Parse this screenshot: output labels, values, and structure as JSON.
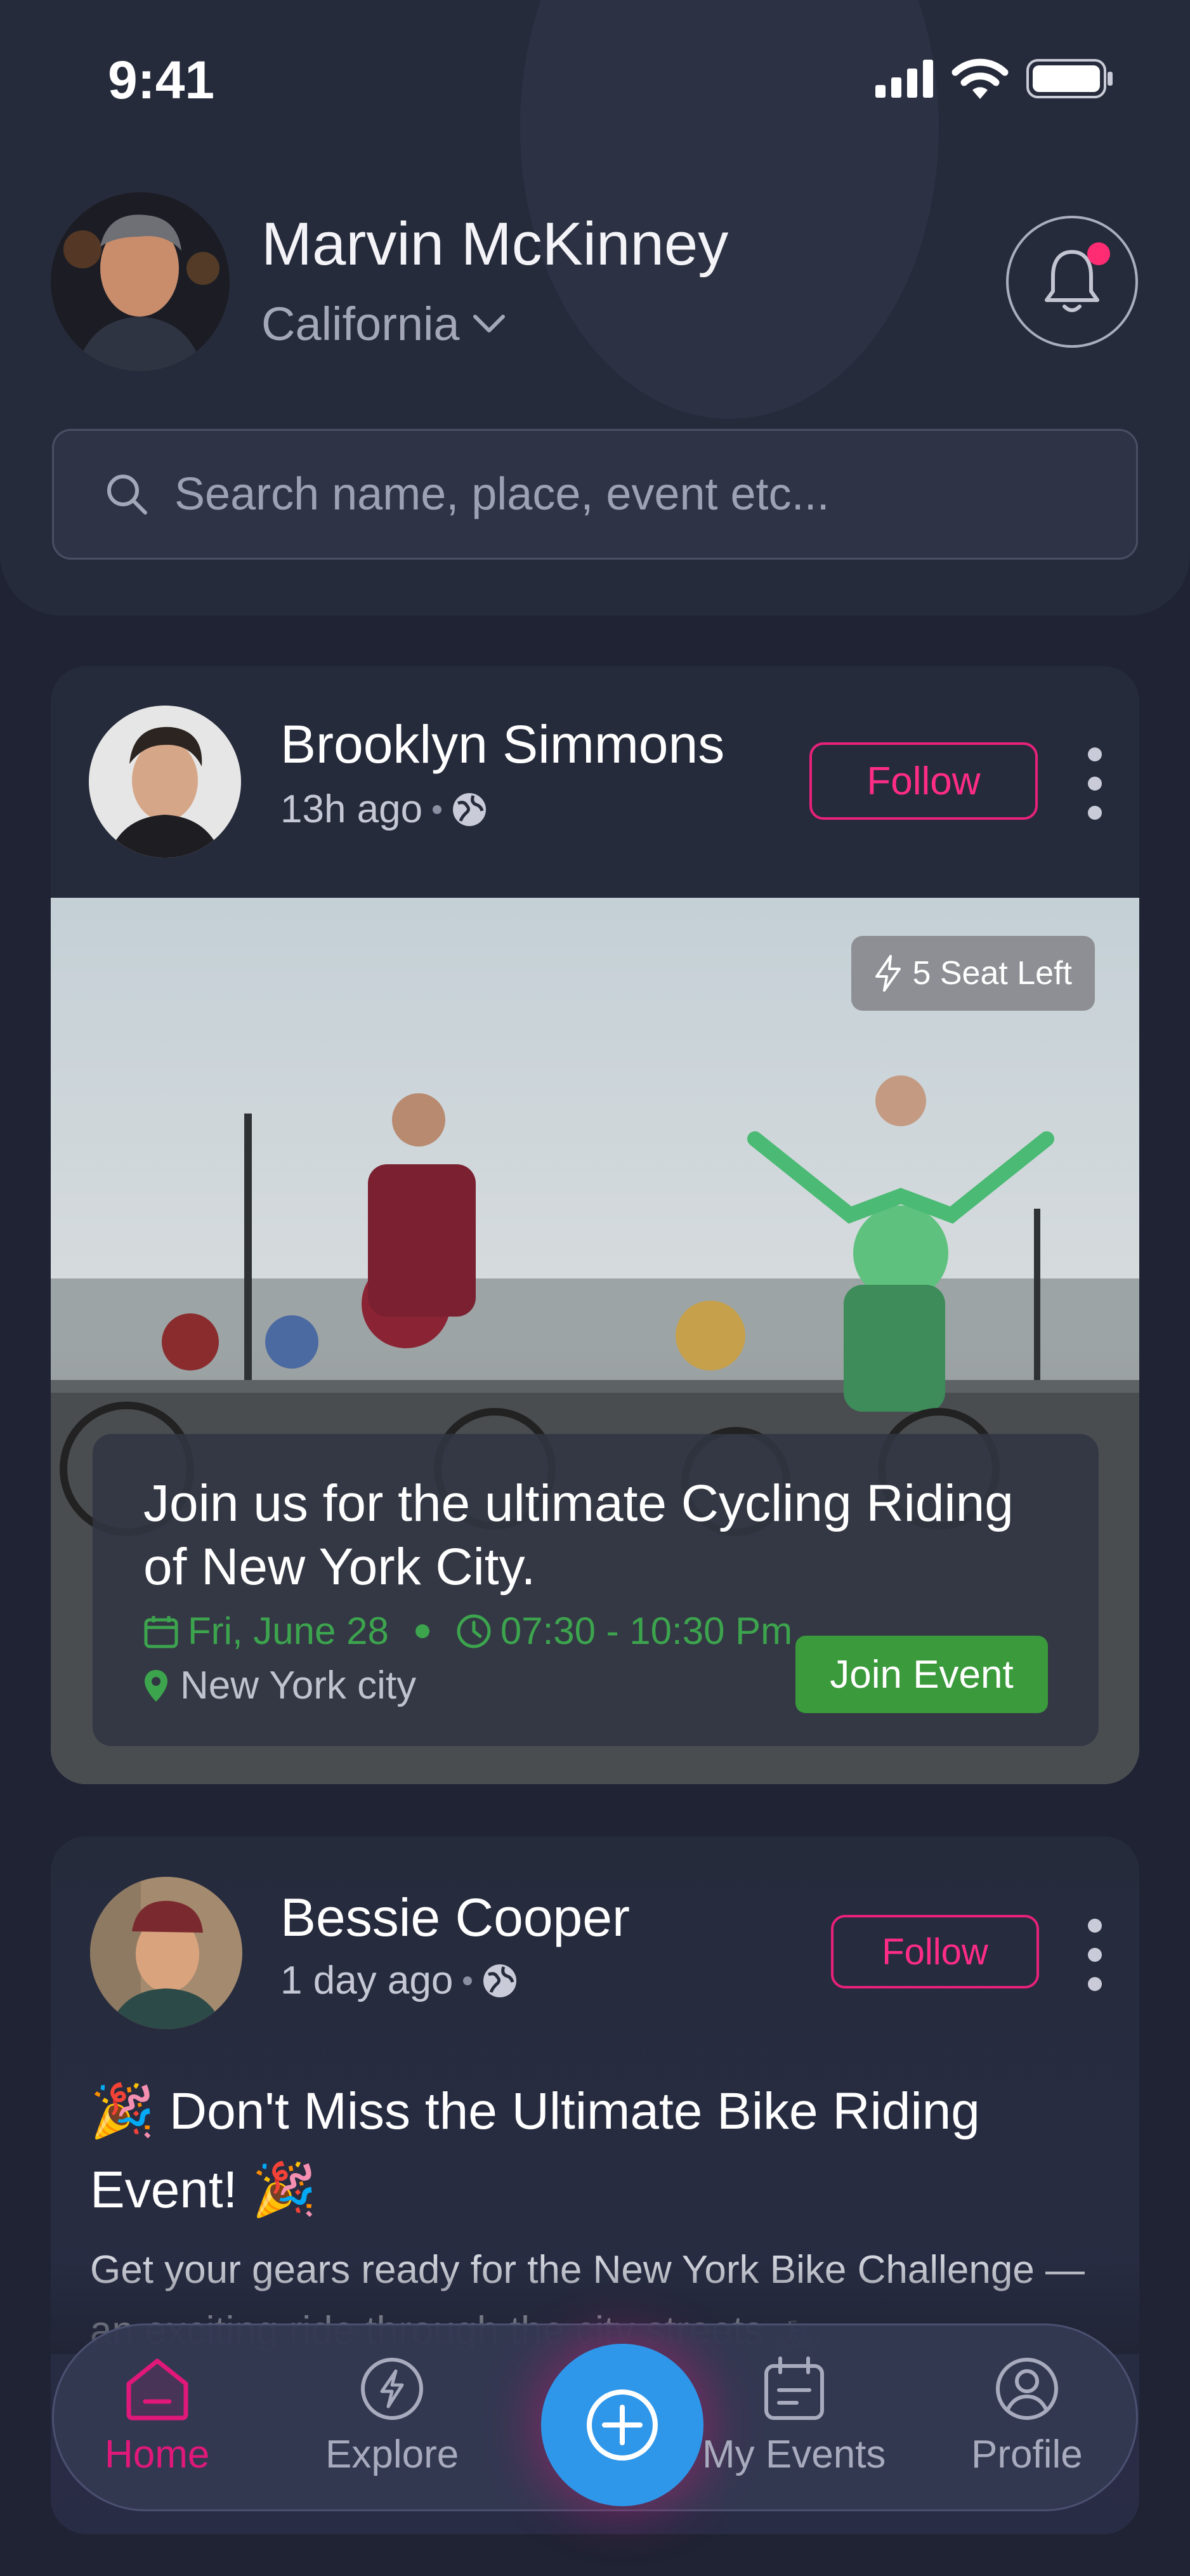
{
  "status_bar": {
    "time": "9:41"
  },
  "header": {
    "user_name": "Marvin McKinney",
    "location": "California",
    "search_placeholder": "Search name, place, event etc..."
  },
  "posts": [
    {
      "author": "Brooklyn Simmons",
      "time_ago": "13h ago",
      "follow_label": "Follow",
      "event": {
        "seats_badge": "5 Seat Left",
        "title": "Join us for the ultimate Cycling Riding  of New York City.",
        "date": "Fri, June 28",
        "time": "07:30 - 10:30 Pm",
        "location": "New York city",
        "join_label": "Join Event"
      }
    },
    {
      "author": "Bessie Cooper",
      "time_ago": "1 day ago",
      "follow_label": "Follow",
      "heading": "🎉 Don't Miss the Ultimate Bike Riding Event! 🎉",
      "body": "Get your gears ready for the New York Bike Challenge — an exciting ride through the city streets 🚲"
    }
  ],
  "tab_bar": {
    "tabs": [
      {
        "label": "Home",
        "icon": "home-icon",
        "active": true
      },
      {
        "label": "Explore",
        "icon": "bolt-icon",
        "active": false
      },
      {
        "label": "My Events",
        "icon": "calendar-icon",
        "active": false
      },
      {
        "label": "Profile",
        "icon": "profile-icon",
        "active": false
      }
    ],
    "create_icon": "plus-icon"
  },
  "colors": {
    "background": "#1f2333",
    "accent_pink": "#e8217a",
    "event_green": "#3b9a3c",
    "fab_blue": "#2f97ea"
  }
}
